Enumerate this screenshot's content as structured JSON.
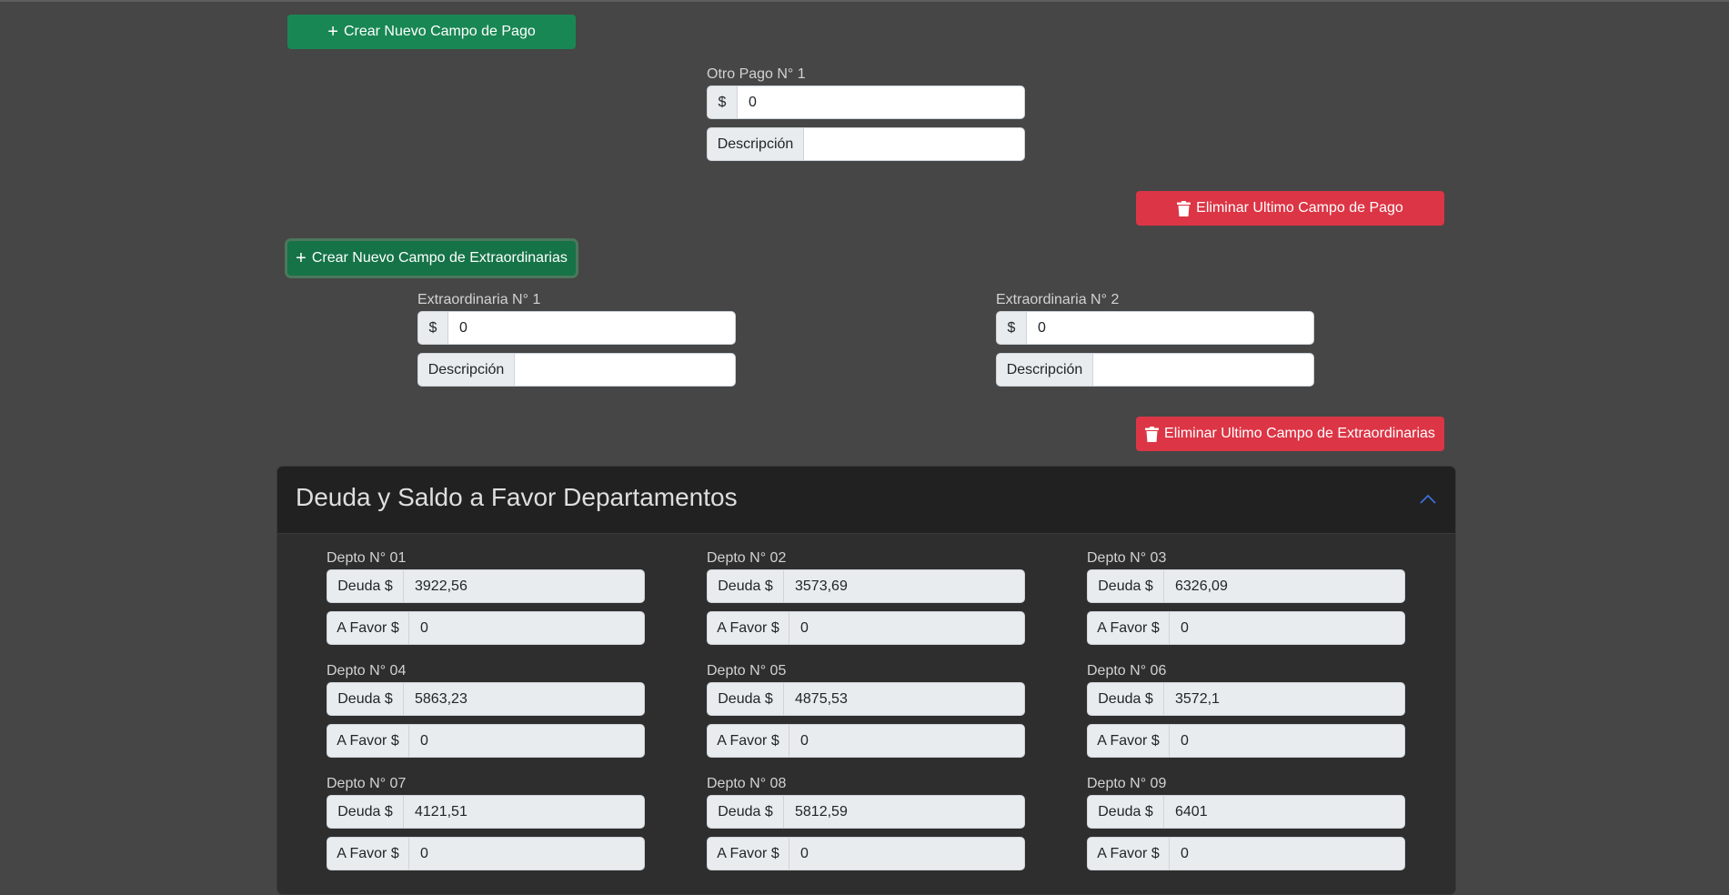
{
  "payments": {
    "create_label": "Crear Nuevo Campo de Pago",
    "delete_label": "Eliminar Ultimo Campo de Pago",
    "fields": [
      {
        "label": "Otro Pago N° 1",
        "currency": "$",
        "amount": "0",
        "desc_label": "Descripción",
        "description": ""
      }
    ]
  },
  "extraordinarias": {
    "create_label": "Crear Nuevo Campo de Extraordinarias",
    "delete_label": "Eliminar Ultimo Campo de Extraordinarias",
    "fields": [
      {
        "label": "Extraordinaria N° 1",
        "currency": "$",
        "amount": "0",
        "desc_label": "Descripción",
        "description": ""
      },
      {
        "label": "Extraordinaria N° 2",
        "currency": "$",
        "amount": "0",
        "desc_label": "Descripción",
        "description": ""
      }
    ]
  },
  "deuda_section": {
    "title": "Deuda y Saldo a Favor Departamentos",
    "debt_label": "Deuda $",
    "credit_label": "A Favor $",
    "depts": [
      {
        "label": "Depto N° 01",
        "deuda": "3922,56",
        "favor": "0"
      },
      {
        "label": "Depto N° 02",
        "deuda": "3573,69",
        "favor": "0"
      },
      {
        "label": "Depto N° 03",
        "deuda": "6326,09",
        "favor": "0"
      },
      {
        "label": "Depto N° 04",
        "deuda": "5863,23",
        "favor": "0"
      },
      {
        "label": "Depto N° 05",
        "deuda": "4875,53",
        "favor": "0"
      },
      {
        "label": "Depto N° 06",
        "deuda": "3572,1",
        "favor": "0"
      },
      {
        "label": "Depto N° 07",
        "deuda": "4121,51",
        "favor": "0"
      },
      {
        "label": "Depto N° 08",
        "deuda": "5812,59",
        "favor": "0"
      },
      {
        "label": "Depto N° 09",
        "deuda": "6401",
        "favor": "0"
      }
    ]
  },
  "icons": {
    "plus": "plus-icon",
    "trash": "trash-icon",
    "collapse": "chevron-up-icon"
  },
  "colors": {
    "success": "#198754",
    "danger": "#dc3545",
    "background": "#464646",
    "card_header": "#212121",
    "card_body": "#2e2e2e",
    "accent": "#3d6fd6"
  }
}
